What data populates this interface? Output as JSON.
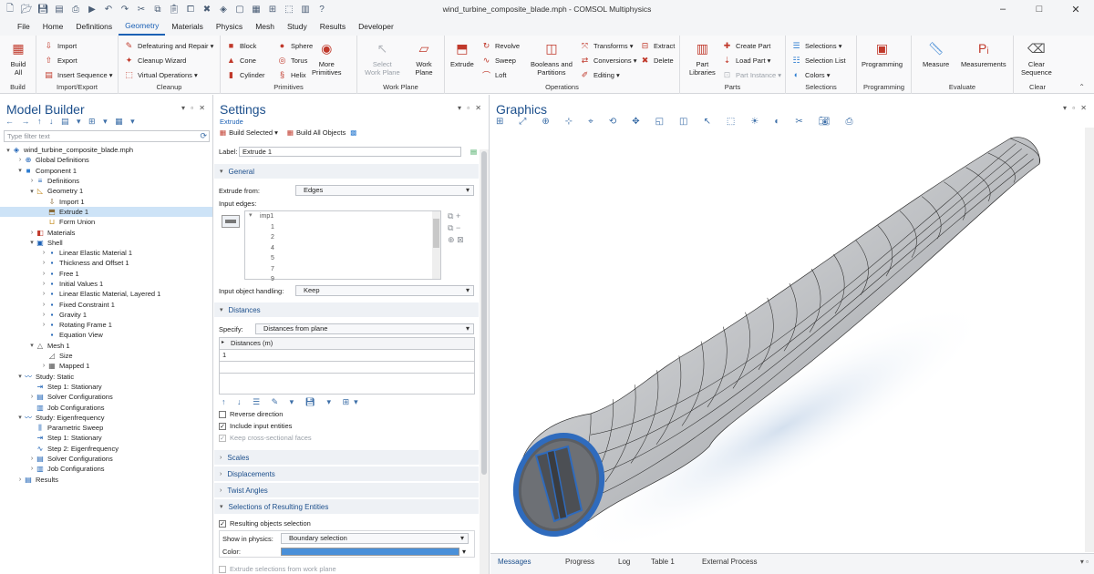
{
  "window": {
    "title": "wind_turbine_composite_blade.mph - COMSOL Multiphysics",
    "quick_access": [
      "new-file-icon",
      "open-folder-icon",
      "save-icon",
      "save-as-icon",
      "print-icon",
      "run-icon",
      "undo-icon",
      "redo-icon",
      "cut-icon",
      "copy-icon",
      "paste-icon",
      "duplicate-icon",
      "delete-icon",
      "model-wizard-icon",
      "blank-model-icon",
      "application-builder-icon",
      "method-editor-icon",
      "physics-builder-icon",
      "window-tile-icon",
      "help-icon"
    ],
    "controls": {
      "minimize": "–",
      "maximize": "□",
      "close": "✕"
    }
  },
  "menubar": {
    "items": [
      "File",
      "Home",
      "Definitions",
      "Geometry",
      "Materials",
      "Physics",
      "Mesh",
      "Study",
      "Results",
      "Developer"
    ],
    "active": "Geometry"
  },
  "ribbon": {
    "groups": [
      {
        "label": "Build",
        "big": [
          {
            "label": "Build\nAll",
            "icon": "build-all-icon",
            "color": "#c0392b"
          }
        ]
      },
      {
        "label": "Import/Export",
        "small": [
          {
            "label": "Import",
            "icon": "import-icon"
          },
          {
            "label": "Export",
            "icon": "export-icon"
          },
          {
            "label": "Insert Sequence",
            "icon": "insert-sequence-icon",
            "dropdown": true
          }
        ]
      },
      {
        "label": "Cleanup",
        "small": [
          {
            "label": "Defeaturing and Repair",
            "icon": "defeaturing-icon",
            "dropdown": true
          },
          {
            "label": "Cleanup Wizard",
            "icon": "cleanup-wizard-icon"
          },
          {
            "label": "Virtual Operations",
            "icon": "virtual-operations-icon",
            "dropdown": true
          }
        ]
      },
      {
        "label": "Primitives",
        "small": [
          {
            "label": "Block",
            "icon": "block-icon"
          },
          {
            "label": "Cone",
            "icon": "cone-icon"
          },
          {
            "label": "Cylinder",
            "icon": "cylinder-icon"
          },
          {
            "label": "Sphere",
            "icon": "sphere-icon"
          },
          {
            "label": "Torus",
            "icon": "torus-icon"
          },
          {
            "label": "Helix",
            "icon": "helix-icon"
          }
        ],
        "big": [
          {
            "label": "More\nPrimitives",
            "icon": "more-primitives-icon",
            "dropdown": true
          }
        ]
      },
      {
        "label": "Work Plane",
        "big": [
          {
            "label": "Select\nWork Plane",
            "icon": "select-work-plane-icon",
            "disabled": true,
            "dropdown": true
          },
          {
            "label": "Work\nPlane",
            "icon": "work-plane-icon"
          }
        ]
      },
      {
        "label": "Operations",
        "big": [
          {
            "label": "Extrude",
            "icon": "extrude-icon"
          },
          {
            "label": "Booleans and\nPartitions",
            "icon": "booleans-icon",
            "dropdown": true
          }
        ],
        "small": [
          {
            "label": "Revolve",
            "icon": "revolve-icon"
          },
          {
            "label": "Sweep",
            "icon": "sweep-icon"
          },
          {
            "label": "Loft",
            "icon": "loft-icon"
          },
          {
            "label": "Transforms",
            "icon": "transforms-icon",
            "dropdown": true
          },
          {
            "label": "Conversions",
            "icon": "conversions-icon",
            "dropdown": true
          },
          {
            "label": "Editing",
            "icon": "editing-icon",
            "dropdown": true
          },
          {
            "label": "Extract",
            "icon": "extract-icon"
          },
          {
            "label": "Delete",
            "icon": "delete-icon"
          }
        ]
      },
      {
        "label": "Parts",
        "big": [
          {
            "label": "Part\nLibraries",
            "icon": "part-libraries-icon"
          }
        ],
        "small": [
          {
            "label": "Create Part",
            "icon": "create-part-icon"
          },
          {
            "label": "Load Part",
            "icon": "load-part-icon",
            "dropdown": true
          },
          {
            "label": "Part Instance",
            "icon": "part-instance-icon",
            "disabled": true,
            "dropdown": true
          }
        ]
      },
      {
        "label": "Selections",
        "small": [
          {
            "label": "Selections",
            "icon": "selections-icon",
            "dropdown": true
          },
          {
            "label": "Selection List",
            "icon": "selection-list-icon"
          },
          {
            "label": "Colors",
            "icon": "colors-icon",
            "dropdown": true
          }
        ]
      },
      {
        "label": "Programming",
        "big": [
          {
            "label": "Programming",
            "icon": "programming-icon",
            "dropdown": true
          }
        ]
      },
      {
        "label": "Evaluate",
        "big": [
          {
            "label": "Measure",
            "icon": "measure-icon"
          },
          {
            "label": "Measurements",
            "icon": "measurements-icon",
            "dropdown": true
          }
        ]
      },
      {
        "label": "Clear",
        "big": [
          {
            "label": "Clear\nSequence",
            "icon": "clear-sequence-icon"
          }
        ]
      }
    ]
  },
  "model_builder": {
    "title": "Model Builder",
    "filter_placeholder": "Type filter text",
    "tree": [
      {
        "label": "wind_turbine_composite_blade.mph",
        "depth": 0,
        "exp": "▾",
        "icon": "model-root-icon",
        "color": "#1c61b5"
      },
      {
        "label": "Global Definitions",
        "depth": 1,
        "exp": "›",
        "icon": "global-definitions-icon",
        "color": "#1c61b5"
      },
      {
        "label": "Component 1",
        "depth": 1,
        "exp": "▾",
        "icon": "component-icon",
        "color": "#2e7dd1"
      },
      {
        "label": "Definitions",
        "depth": 2,
        "exp": "›",
        "icon": "definitions-icon",
        "color": "#1c61b5"
      },
      {
        "label": "Geometry 1",
        "depth": 2,
        "exp": "▾",
        "icon": "geometry-icon",
        "color": "#c48a1c"
      },
      {
        "label": "Import 1",
        "depth": 3,
        "exp": "",
        "icon": "import-node-icon",
        "color": "#8a6d3b"
      },
      {
        "label": "Extrude 1",
        "depth": 3,
        "exp": "",
        "icon": "extrude-node-icon",
        "color": "#8a6d3b",
        "selected": true
      },
      {
        "label": "Form Union",
        "depth": 3,
        "exp": "",
        "icon": "form-union-icon",
        "color": "#c48a1c"
      },
      {
        "label": "Materials",
        "depth": 2,
        "exp": "›",
        "icon": "materials-icon",
        "color": "#c0392b"
      },
      {
        "label": "Shell",
        "depth": 2,
        "exp": "▾",
        "icon": "shell-icon",
        "color": "#1c61b5"
      },
      {
        "label": "Linear Elastic Material 1",
        "depth": 3,
        "exp": "›",
        "icon": "material-model-icon",
        "color": "#1c61b5"
      },
      {
        "label": "Thickness and Offset 1",
        "depth": 3,
        "exp": "›",
        "icon": "thickness-icon",
        "color": "#1c61b5"
      },
      {
        "label": "Free 1",
        "depth": 3,
        "exp": "›",
        "icon": "free-icon",
        "color": "#1c61b5"
      },
      {
        "label": "Initial Values 1",
        "depth": 3,
        "exp": "›",
        "icon": "initial-values-icon",
        "color": "#1c61b5"
      },
      {
        "label": "Linear Elastic Material, Layered 1",
        "depth": 3,
        "exp": "›",
        "icon": "layered-material-icon",
        "color": "#1c61b5"
      },
      {
        "label": "Fixed Constraint 1",
        "depth": 3,
        "exp": "›",
        "icon": "fixed-constraint-icon",
        "color": "#1c61b5"
      },
      {
        "label": "Gravity 1",
        "depth": 3,
        "exp": "›",
        "icon": "gravity-icon",
        "color": "#1c61b5"
      },
      {
        "label": "Rotating Frame 1",
        "depth": 3,
        "exp": "›",
        "icon": "rotating-frame-icon",
        "color": "#1c61b5"
      },
      {
        "label": "Equation View",
        "depth": 3,
        "exp": "",
        "icon": "equation-view-icon",
        "color": "#1c61b5"
      },
      {
        "label": "Mesh 1",
        "depth": 2,
        "exp": "▾",
        "icon": "mesh-icon",
        "color": "#555555"
      },
      {
        "label": "Size",
        "depth": 3,
        "exp": "",
        "icon": "size-icon",
        "color": "#555555"
      },
      {
        "label": "Mapped 1",
        "depth": 3,
        "exp": "›",
        "icon": "mapped-icon",
        "color": "#555555"
      },
      {
        "label": "Study: Static",
        "depth": 1,
        "exp": "▾",
        "icon": "study-icon",
        "color": "#1c61b5"
      },
      {
        "label": "Step 1: Stationary",
        "depth": 2,
        "exp": "",
        "icon": "stationary-icon",
        "color": "#1c61b5"
      },
      {
        "label": "Solver Configurations",
        "depth": 2,
        "exp": "›",
        "icon": "solver-icon",
        "color": "#1c61b5"
      },
      {
        "label": "Job Configurations",
        "depth": 2,
        "exp": "",
        "icon": "job-icon",
        "color": "#1c61b5"
      },
      {
        "label": "Study: Eigenfrequency",
        "depth": 1,
        "exp": "▾",
        "icon": "study-icon",
        "color": "#1c61b5"
      },
      {
        "label": "Parametric Sweep",
        "depth": 2,
        "exp": "",
        "icon": "parametric-icon",
        "color": "#1c61b5"
      },
      {
        "label": "Step 1: Stationary",
        "depth": 2,
        "exp": "",
        "icon": "stationary-icon",
        "color": "#1c61b5"
      },
      {
        "label": "Step 2: Eigenfrequency",
        "depth": 2,
        "exp": "",
        "icon": "eigenfrequency-icon",
        "color": "#1c61b5"
      },
      {
        "label": "Solver Configurations",
        "depth": 2,
        "exp": "›",
        "icon": "solver-icon",
        "color": "#1c61b5"
      },
      {
        "label": "Job Configurations",
        "depth": 2,
        "exp": "›",
        "icon": "job-icon",
        "color": "#1c61b5"
      },
      {
        "label": "Results",
        "depth": 1,
        "exp": "›",
        "icon": "results-icon",
        "color": "#1c61b5"
      }
    ]
  },
  "settings": {
    "title": "Settings",
    "subtitle": "Extrude",
    "build_selected": "Build Selected",
    "build_all": "Build All Objects",
    "label_caption": "Label:",
    "label_value": "Extrude 1",
    "general": {
      "header": "General",
      "extrude_from_label": "Extrude from:",
      "extrude_from_value": "Edges",
      "input_edges_label": "Input edges:",
      "input_edges": [
        "imp1",
        "1",
        "2",
        "4",
        "5",
        "7",
        "9"
      ],
      "input_handling_label": "Input object handling:",
      "input_handling_value": "Keep"
    },
    "distances": {
      "header": "Distances",
      "specify_label": "Specify:",
      "specify_value": "Distances from plane",
      "table_header": "Distances (m)",
      "rows": [
        "1"
      ]
    },
    "checks": [
      {
        "label": "Reverse direction",
        "checked": false,
        "disabled": false
      },
      {
        "label": "Include input entities",
        "checked": true,
        "disabled": false
      },
      {
        "label": "Keep cross-sectional faces",
        "checked": true,
        "disabled": true
      }
    ],
    "sections": [
      "Scales",
      "Displacements",
      "Twist Angles",
      "Selections of Resulting Entities"
    ],
    "resulting": {
      "checkbox_label": "Resulting objects selection",
      "show_label": "Show in physics:",
      "show_value": "Boundary selection",
      "color_label": "Color:",
      "color_value": "#4a90d9",
      "extrude_sel_label": "Extrude selections from work plane"
    }
  },
  "graphics": {
    "title": "Graphics",
    "toolbar_icons": [
      "zoom-box-icon",
      "zoom-extents-icon",
      "zoom-in-icon",
      "go-to-view-icon",
      "zoom-selected-icon",
      "rotate-icon",
      "move-icon",
      "default-view-icon",
      "transparency-icon",
      "select-icon",
      "wireframe-icon",
      "scene-light-icon",
      "render-icon",
      "clip-icon",
      "camera-icon",
      "print-graphics-icon"
    ],
    "blade_color": "#c7c9cc",
    "rim_color": "#2f6bbd"
  },
  "message_tabs": [
    "Messages",
    "Progress",
    "Log",
    "Table 1",
    "External Process"
  ]
}
